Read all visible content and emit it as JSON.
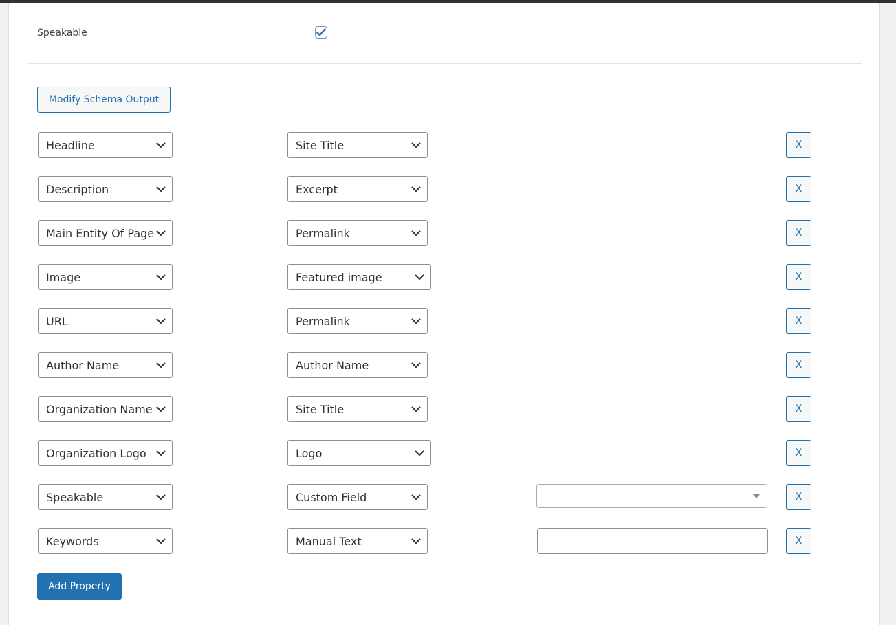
{
  "speakable_setting": {
    "label": "Speakable",
    "checked": true,
    "check_color": "#2271b1"
  },
  "modify_button": {
    "label": "Modify Schema Output"
  },
  "remove_label": "X",
  "add_button": {
    "label": "Add Property"
  },
  "icons": {
    "dropdown": "chevron-down-icon",
    "check": "checkmark-icon",
    "select2": "caret-down-icon"
  },
  "colors": {
    "accent": "#2271b1",
    "border": "#8c8f94",
    "text": "#2c3338"
  },
  "rows": [
    {
      "property": "Headline",
      "source": "Site Title"
    },
    {
      "property": "Description",
      "source": "Excerpt"
    },
    {
      "property": "Main Entity Of Page",
      "source": "Permalink"
    },
    {
      "property": "Image",
      "source": "Featured image"
    },
    {
      "property": "URL",
      "source": "Permalink"
    },
    {
      "property": "Author Name",
      "source": "Author Name"
    },
    {
      "property": "Organization Name",
      "source": "Site Title"
    },
    {
      "property": "Organization Logo",
      "source": "Logo"
    },
    {
      "property": "Speakable",
      "source": "Custom Field",
      "extra": "select",
      "extra_value": ""
    },
    {
      "property": "Keywords",
      "source": "Manual Text",
      "extra": "text",
      "extra_value": ""
    }
  ]
}
